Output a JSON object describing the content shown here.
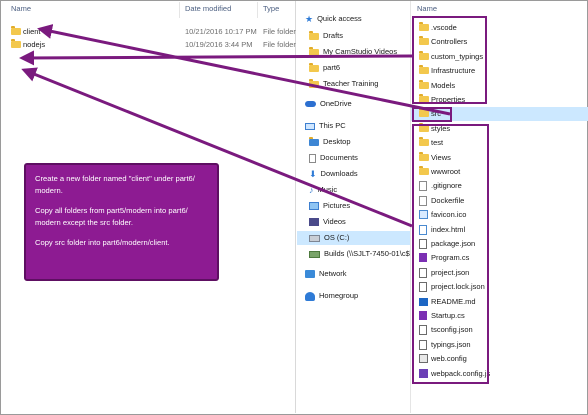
{
  "left_pane": {
    "headers": {
      "name": "Name",
      "date": "Date modified",
      "type": "Type"
    },
    "rows": [
      {
        "name": "client",
        "date": "10/21/2016 10:17 PM",
        "type": "File folder"
      },
      {
        "name": "nodejs",
        "date": "10/19/2016 3:44 PM",
        "type": "File folder"
      }
    ]
  },
  "nav": {
    "quick_access": "Quick access",
    "quick_items": [
      "Drafts",
      "My CamStudio Videos",
      "part6",
      "Teacher Training"
    ],
    "onedrive": "OneDrive",
    "this_pc": "This PC",
    "pc_items": [
      "Desktop",
      "Documents",
      "Downloads",
      "Music",
      "Pictures",
      "Videos"
    ],
    "os_drive": "OS (C:)",
    "network_drive": "Builds (\\\\SJLT-7450-01\\c$\\Re",
    "network": "Network",
    "homegroup": "Homegroup"
  },
  "right_pane": {
    "header": "Name",
    "items": [
      {
        "name": ".vscode",
        "icon": "folder-icon"
      },
      {
        "name": "Controllers",
        "icon": "folder-icon"
      },
      {
        "name": "custom_typings",
        "icon": "folder-icon"
      },
      {
        "name": "Infrastructure",
        "icon": "folder-icon"
      },
      {
        "name": "Models",
        "icon": "folder-icon"
      },
      {
        "name": "Properties",
        "icon": "folder-icon"
      },
      {
        "name": "src",
        "icon": "folder-icon"
      },
      {
        "name": "styles",
        "icon": "folder-icon"
      },
      {
        "name": "test",
        "icon": "folder-icon"
      },
      {
        "name": "Views",
        "icon": "folder-icon"
      },
      {
        "name": "wwwroot",
        "icon": "folder-icon"
      },
      {
        "name": ".gitignore",
        "icon": "file-icon"
      },
      {
        "name": "Dockerfile",
        "icon": "file-icon"
      },
      {
        "name": "favicon.ico",
        "icon": "favicon-icon"
      },
      {
        "name": "index.html",
        "icon": "html-icon"
      },
      {
        "name": "package.json",
        "icon": "json-icon"
      },
      {
        "name": "Program.cs",
        "icon": "csharp-icon"
      },
      {
        "name": "project.json",
        "icon": "json-icon"
      },
      {
        "name": "project.lock.json",
        "icon": "json-icon"
      },
      {
        "name": "README.md",
        "icon": "markdown-icon"
      },
      {
        "name": "Startup.cs",
        "icon": "csharp-icon"
      },
      {
        "name": "tsconfig.json",
        "icon": "json-icon"
      },
      {
        "name": "typings.json",
        "icon": "json-icon"
      },
      {
        "name": "web.config",
        "icon": "config-icon"
      },
      {
        "name": "webpack.config.js",
        "icon": "webpack-icon"
      }
    ]
  },
  "callout": {
    "line1": "Create a new folder named \"client\" under part6/ modern.",
    "line2": "Copy all folders from part5/modern into part6/ modern except the src folder.",
    "line3": "Copy src folder into part6/modern/client."
  },
  "colors": {
    "annotation_purple": "#8d1b92",
    "selection_blue": "#cce8ff",
    "folder_yellow": "#f3c84d"
  }
}
